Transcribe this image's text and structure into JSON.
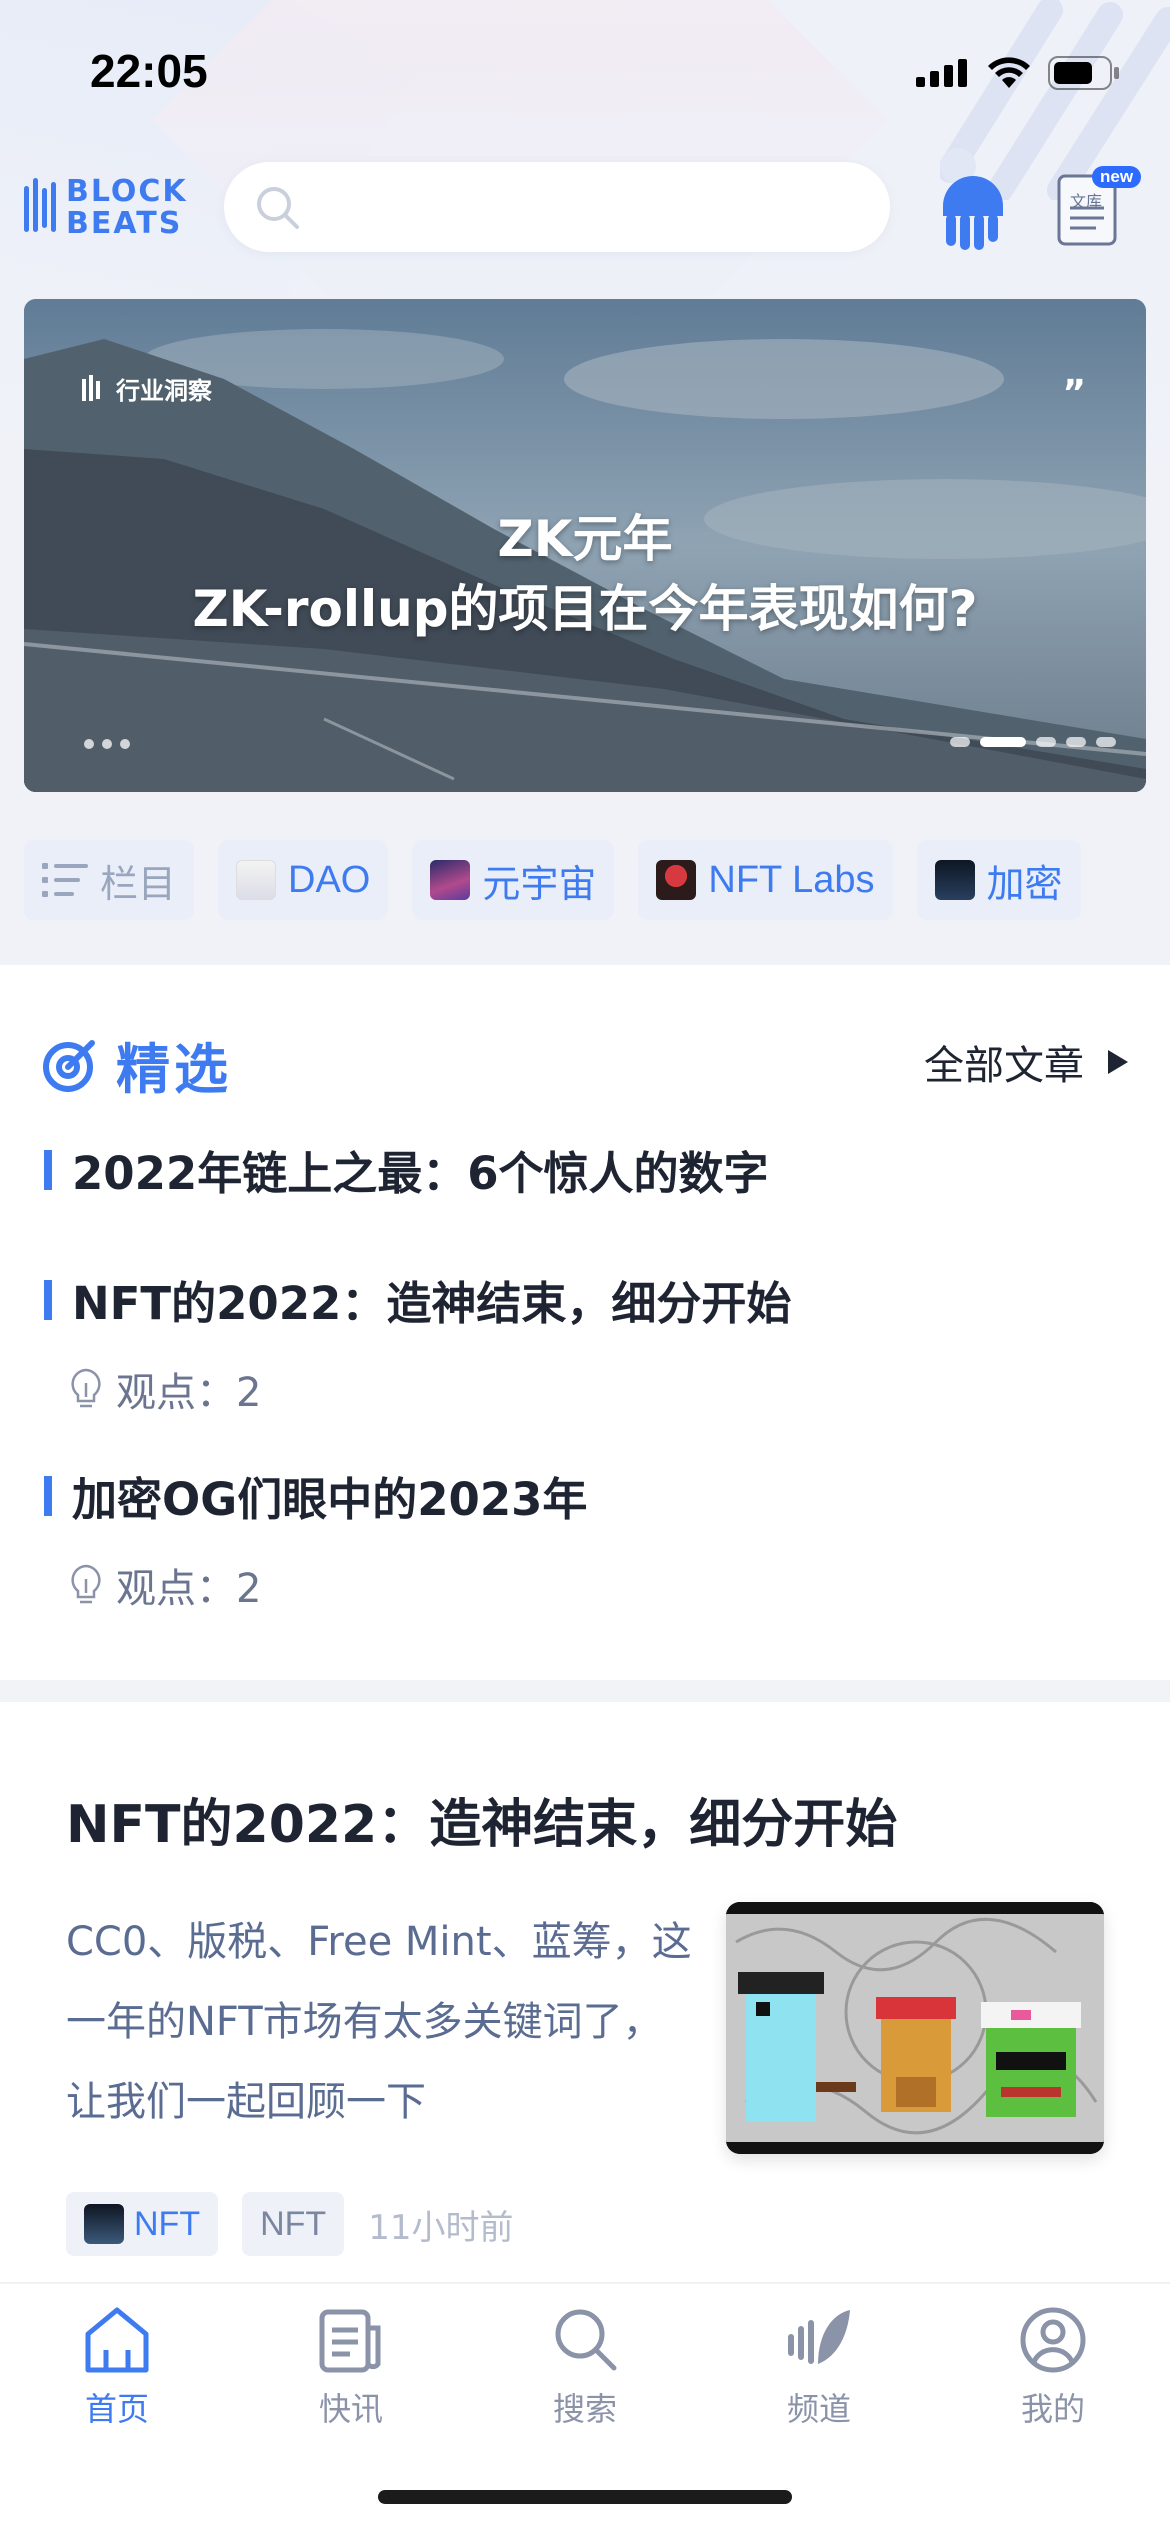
{
  "status_bar": {
    "time": "22:05"
  },
  "header": {
    "logo_text_1": "BLOCK",
    "logo_text_2": "BEATS",
    "search_placeholder": "",
    "library_badge": "new",
    "library_label": "文库"
  },
  "banner": {
    "tag": "行业洞察",
    "quote_mark": "”",
    "title_line1": "ZK元年",
    "title_line2": "ZK-rollup的项目在今年表现如何?",
    "page_count": 5,
    "active_page": 2
  },
  "categories": [
    {
      "label": "栏目",
      "icon": "list-icon"
    },
    {
      "label": "DAO",
      "icon": "dao-thumb"
    },
    {
      "label": "元宇宙",
      "icon": "metaverse-thumb"
    },
    {
      "label": "NFT Labs",
      "icon": "nft-labs-thumb"
    },
    {
      "label": "加密",
      "icon": "crypto-thumb"
    }
  ],
  "featured": {
    "title": "精选",
    "all_articles": "全部文章",
    "items": [
      {
        "title": "2022年链上之最：6个惊人的数字",
        "views": ""
      },
      {
        "title": "NFT的2022：造神结束，细分开始",
        "views": "观点：2"
      },
      {
        "title": "加密OG们眼中的2023年",
        "views": "观点：2"
      }
    ]
  },
  "article": {
    "title": "NFT的2022：造神结束，细分开始",
    "summary": "CC0、版税、Free Mint、蓝筹，这一年的NFT市场有太多关键词了，让我们一起回顾一下",
    "tag1": "NFT",
    "tag2": "NFT",
    "time": "11小时前"
  },
  "tabbar": {
    "items": [
      {
        "label": "首页",
        "icon": "home-icon",
        "active": true
      },
      {
        "label": "快讯",
        "icon": "news-icon",
        "active": false
      },
      {
        "label": "搜索",
        "icon": "search-icon",
        "active": false
      },
      {
        "label": "频道",
        "icon": "channel-icon",
        "active": false
      },
      {
        "label": "我的",
        "icon": "profile-icon",
        "active": false
      }
    ]
  },
  "colors": {
    "accent": "#3e7bf0",
    "text": "#1f2433",
    "muted": "#8a93a8"
  }
}
